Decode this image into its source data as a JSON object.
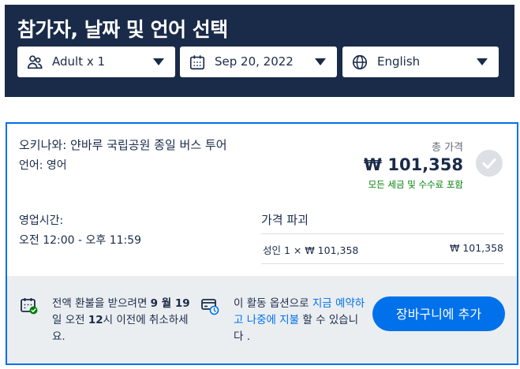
{
  "header": {
    "title": "참가자, 날짜 및 언어 선택",
    "participants": {
      "value": "Adult x 1",
      "icon": "people-icon"
    },
    "date": {
      "value": "Sep 20, 2022",
      "icon": "calendar-icon"
    },
    "language": {
      "value": "English",
      "icon": "globe-icon"
    }
  },
  "option": {
    "title": "오키나와: 얀바루 국립공원 종일 버스 투어",
    "language_line": "언어: 영어",
    "total_label": "총 가격",
    "total_price": "₩ 101,358",
    "tax_note": "모든 세금 및 수수료 포함",
    "hours_label": "영업시간:",
    "hours_value": "오전 12:00 - 오후 11:59",
    "breakdown_label": "가격 파괴",
    "breakdown": {
      "description": "성인 1 × ₩ 101,358",
      "amount": "₩ 101,358"
    }
  },
  "footer": {
    "cancel": {
      "part1": "전액 환불을 받으려면 ",
      "bold1": "9 월 19",
      "part2": "일 오전 ",
      "bold2": "12",
      "part3": "시 이전에 취소하세요."
    },
    "reserve": {
      "part1": "이 활동 옵션으로 ",
      "link": "지금 예약하고 나중에 지불",
      "part2": " 할 수 있습니다 ."
    },
    "add_to_cart": "장바구니에 추가"
  },
  "colors": {
    "navy": "#1a2b49",
    "accent": "#0071eb",
    "green": "#008009",
    "footer_bg": "#ebeef1"
  }
}
